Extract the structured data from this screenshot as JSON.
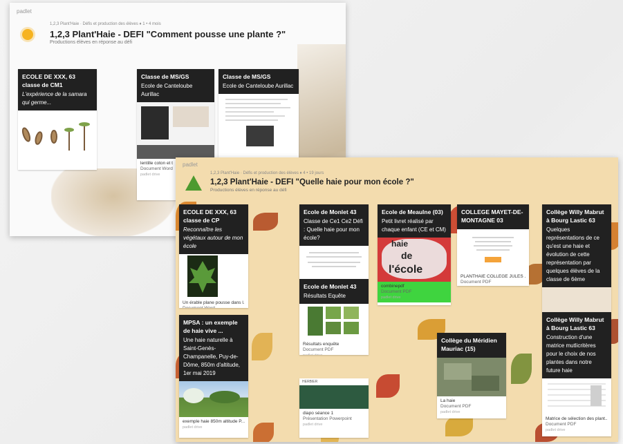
{
  "win1": {
    "app": "padlet",
    "breadcrumb": "1,2,3 Plant'Haie · Défis et production des élèves  ♦  1  •  4 mois",
    "title": "1,2,3 Plant'Haie - DEFI \"Comment pousse une plante ?\"",
    "subtitle": "Productions élèves en réponse au défi",
    "cards": [
      {
        "head": "ECOLE DE XXX, 63 classe de CM1",
        "note": "L'expérience de la samara qui germe...",
        "file": "",
        "type": "",
        "src": ""
      },
      {
        "head": "Classe de MS/GS",
        "note": "Ecole de Canteloube Aurillac",
        "file": "lentille coton et t",
        "type": "Document Word",
        "src": "padlet drive"
      },
      {
        "head": "Classe de MS/GS",
        "note": "Ecole de Canteloube Aurillac",
        "file": "",
        "type": "",
        "src": ""
      }
    ]
  },
  "win2": {
    "app": "padlet",
    "breadcrumb": "1,2,3 Plant'Haie · Défis et production des élèves  ♦  4  •  19 jours",
    "title": "1,2,3 Plant'Haie - DEFI \"Quelle haie pour mon école ?\"",
    "subtitle": "Productions élèves en réponse au défi",
    "cards": {
      "c1": {
        "head": "ECOLE DE XXX, 63 classe de CP",
        "note": "Reconnaître les végétaux autour de mon école",
        "file": "Un érable plane pousse dans l...",
        "type": "Document Word",
        "src": "padlet drive"
      },
      "c2": {
        "head": "MPSA : un exemple de haie vive ...",
        "note": "Une haie naturelle à Saint-Genès-Champanelle, Puy-de-Dôme, 850m d'altitude, 1er mai 2019",
        "file": "exemple haie 850m altitude P...",
        "type": "",
        "src": "padlet drive"
      },
      "c3": {
        "head": "Ecole de Monlet 43",
        "note": "Classe de Ce1 Ce2 Défi : Quelle haie pour mon école?",
        "file": "",
        "type": "",
        "src": ""
      },
      "c4": {
        "head": "Ecole de Monlet 43",
        "note": "Résultats Equête",
        "file": "Résultats enquête",
        "type": "Document PDF",
        "src": "padlet drive"
      },
      "c5": {
        "head": "",
        "note": "",
        "file": "diapo séance 1",
        "type": "Présentation Powerpoint",
        "src": "padlet drive",
        "label": "HERBIER"
      },
      "c6": {
        "head": "Ecole de Meaulne (03)",
        "note": "Petit livret réalisé par chaque enfant (CE et CM)",
        "file": "combinepdf",
        "type": "Document PDF",
        "src": "padlet drive",
        "img1": "haie",
        "img2": "de",
        "img3": "l'école"
      },
      "c7": {
        "head": "COLLEGE MAYET-DE-MONTAGNE 03",
        "note": "",
        "file": "PLANTHAIE COLLEGE JULES ...",
        "type": "Document PDF",
        "src": "padlet drive"
      },
      "c8": {
        "head": "Collège du Méridien Mauriac (15)",
        "note": "",
        "file": "La haie",
        "type": "Document PDF",
        "src": "padlet drive"
      },
      "c9": {
        "head": "Collège Willy Mabrut à Bourg Lastic 63",
        "note": "Quelques représentations de ce qu'est une haie et évolution de cette représentation par quelques élèves de la classe de 6ème",
        "file": "",
        "type": "",
        "src": ""
      },
      "c10": {
        "head": "Collège Willy Mabrut à Bourg Lastic 63",
        "note": "Construction d'une matrice mutlicritères pour le choix de nos plantes dans notre future haie",
        "file": "Matrice de sélection des plant...",
        "type": "Document PDF",
        "src": "padlet drive"
      }
    }
  }
}
